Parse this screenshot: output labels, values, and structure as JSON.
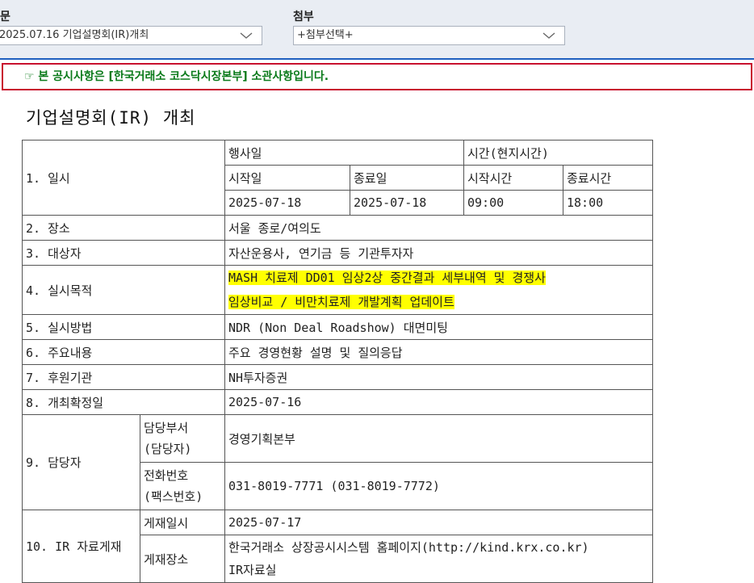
{
  "toolbar": {
    "doc_label": "문",
    "doc_select_value": "2025.07.16  기업설명회(IR)개최",
    "attach_label": "첨부",
    "attach_select_value": "+첨부선택+"
  },
  "notice": {
    "text": "☞ 본 공시사항은 [한국거래소 코스닥시장본부] 소관사항입니다."
  },
  "title": "기업설명회(IR) 개최",
  "table": {
    "r1_label": "1. 일시",
    "event_day": "행사일",
    "time_local": "시간(현지시간)",
    "start_date_label": "시작일",
    "end_date_label": "종료일",
    "start_time_label": "시작시간",
    "end_time_label": "종료시간",
    "start_date": "2025-07-18",
    "end_date": "2025-07-18",
    "start_time": "09:00",
    "end_time": "18:00",
    "r2_label": "2. 장소",
    "r2_value": "서울 종로/여의도",
    "r3_label": "3. 대상자",
    "r3_value": "자산운용사, 연기금 등 기관투자자",
    "r4_label": "4. 실시목적",
    "r4_value_1": "MASH 치료제 DD01 임상2상 중간결과 세부내역 및 경쟁사",
    "r4_value_2": "임상비교 / 비만치료제 개발계획 업데이트",
    "r5_label": "5. 실시방법",
    "r5_value": "NDR (Non Deal Roadshow) 대면미팅",
    "r6_label": "6. 주요내용",
    "r6_value": "주요 경영현황 설명 및 질의응답",
    "r7_label": "7. 후원기관",
    "r7_value": "NH투자증권",
    "r8_label": "8. 개최확정일",
    "r8_value": "2025-07-16",
    "r9_label": "9. 담당자",
    "dept_label_1": "담당부서",
    "dept_label_2": "(담당자)",
    "dept_value": "경영기획본부",
    "phone_label_1": "전화번호",
    "phone_label_2": "(팩스번호)",
    "phone_value": "031-8019-7771 (031-8019-7772)",
    "r10_label": "10. IR 자료게재",
    "post_date_label": "게재일시",
    "post_date_value": "2025-07-17",
    "post_place_label": "게재장소",
    "post_place_value_1": "한국거래소 상장공시시스템 홈페이지(http://kind.krx.co.kr)",
    "post_place_value_2": "IR자료실"
  },
  "colors": {
    "notice_border": "#c8102e",
    "notice_text": "#0a7a1a",
    "highlight": "#ffff00",
    "frame_top": "#1f5fbf"
  }
}
